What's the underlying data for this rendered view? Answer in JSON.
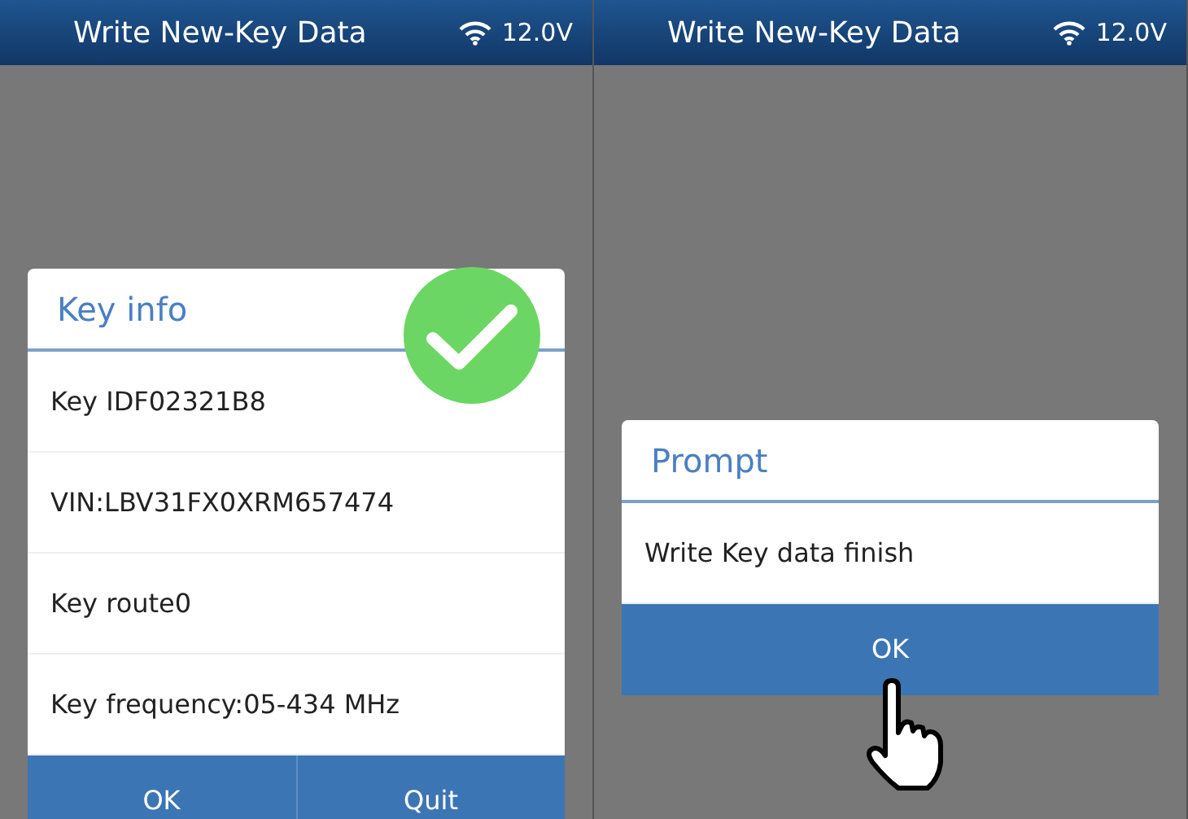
{
  "screens": [
    {
      "header": {
        "title": "Write New-Key Data",
        "voltage": "12.0V"
      },
      "dialog": {
        "title": "Key info",
        "rows": [
          "Key IDF02321B8",
          "VIN:LBV31FX0XRM657474",
          "Key route0",
          "Key frequency:05-434 MHz"
        ],
        "buttons": [
          "OK",
          "Quit"
        ]
      },
      "overlay": {
        "kind": "check"
      }
    },
    {
      "header": {
        "title": "Write New-Key Data",
        "voltage": "12.0V"
      },
      "dialog": {
        "title": "Prompt",
        "rows": [
          "Write Key data finish"
        ],
        "buttons": [
          "OK"
        ]
      },
      "overlay": {
        "kind": "hand"
      }
    }
  ]
}
